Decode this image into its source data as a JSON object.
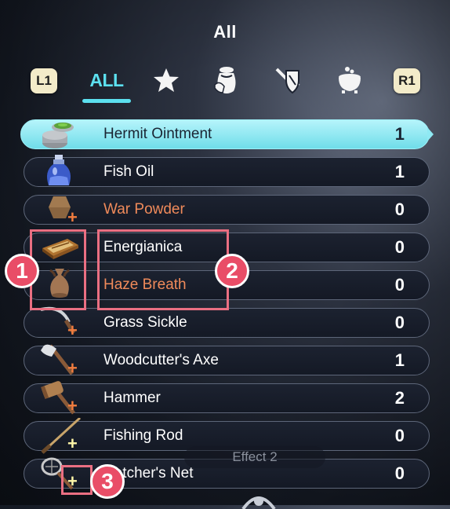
{
  "header": {
    "title": "All"
  },
  "tabs": {
    "left_button": "L1",
    "right_button": "R1",
    "all_label": "ALL",
    "icons": [
      "star-icon",
      "pouch-icon",
      "sword-shield-icon",
      "cauldron-icon"
    ]
  },
  "items": [
    {
      "name": "Hermit Ointment",
      "qty": "1",
      "name_color": "white",
      "selected": true,
      "icon": "ointment-jar-icon",
      "plus": ""
    },
    {
      "name": "Fish Oil",
      "qty": "1",
      "name_color": "white",
      "selected": false,
      "icon": "potion-bottle-icon",
      "plus": ""
    },
    {
      "name": "War Powder",
      "qty": "0",
      "name_color": "orange",
      "selected": false,
      "icon": "powder-icon",
      "plus": "orange"
    },
    {
      "name": "Energianica",
      "qty": "0",
      "name_color": "white",
      "selected": false,
      "icon": "box-icon",
      "plus": ""
    },
    {
      "name": "Haze Breath",
      "qty": "0",
      "name_color": "orange",
      "selected": false,
      "icon": "vase-icon",
      "plus": ""
    },
    {
      "name": "Grass Sickle",
      "qty": "0",
      "name_color": "white",
      "selected": false,
      "icon": "sickle-icon",
      "plus": "orange"
    },
    {
      "name": "Woodcutter's Axe",
      "qty": "1",
      "name_color": "white",
      "selected": false,
      "icon": "axe-icon",
      "plus": "orange"
    },
    {
      "name": "Hammer",
      "qty": "2",
      "name_color": "white",
      "selected": false,
      "icon": "hammer-icon",
      "plus": "orange"
    },
    {
      "name": "Fishing Rod",
      "qty": "0",
      "name_color": "white",
      "selected": false,
      "icon": "fishing-rod-icon",
      "plus": "yellow"
    },
    {
      "name": "Catcher's Net",
      "qty": "0",
      "name_color": "white",
      "selected": false,
      "icon": "net-icon",
      "plus": "yellow"
    }
  ],
  "plus_symbol": "+",
  "callouts": [
    "1",
    "2",
    "3"
  ],
  "effect_label": "Effect 2",
  "colors": {
    "accent": "#5ce0ef",
    "callout": "#e94d67",
    "orange_text": "#ef8a5a",
    "plus_orange": "#f27d3f",
    "plus_yellow": "#fff7a8"
  }
}
